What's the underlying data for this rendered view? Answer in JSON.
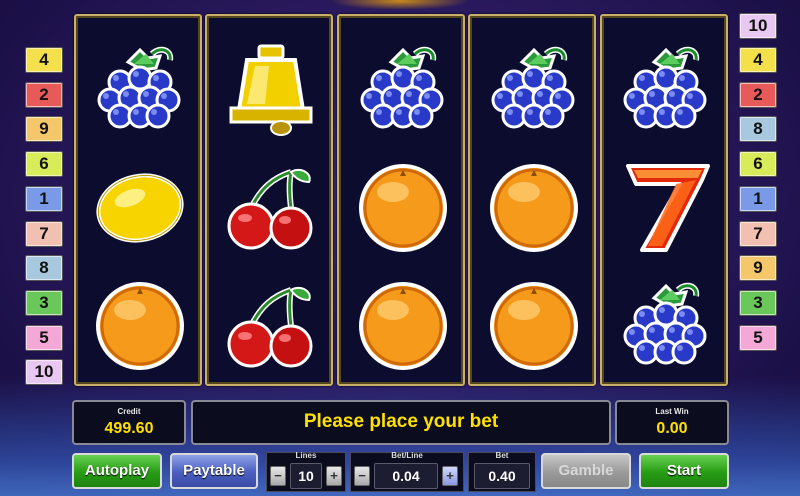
{
  "left_markers": [
    {
      "label": "4",
      "color": "#f4e04a"
    },
    {
      "label": "2",
      "color": "#e85a5a"
    },
    {
      "label": "9",
      "color": "#f4c86a"
    },
    {
      "label": "6",
      "color": "#d8ec5a"
    },
    {
      "label": "1",
      "color": "#7a9ae8"
    },
    {
      "label": "7",
      "color": "#f2c0b0"
    },
    {
      "label": "8",
      "color": "#a8c8e0"
    },
    {
      "label": "3",
      "color": "#6ac85a"
    },
    {
      "label": "5",
      "color": "#f4a8d8"
    },
    {
      "label": "10",
      "color": "#e8c8f0"
    }
  ],
  "right_markers": [
    {
      "label": "10",
      "color": "#e8c8f0"
    },
    {
      "label": "4",
      "color": "#f4e04a"
    },
    {
      "label": "2",
      "color": "#e85a5a"
    },
    {
      "label": "8",
      "color": "#a8c8e0"
    },
    {
      "label": "6",
      "color": "#d8ec5a"
    },
    {
      "label": "1",
      "color": "#7a9ae8"
    },
    {
      "label": "7",
      "color": "#f2c0b0"
    },
    {
      "label": "9",
      "color": "#f4c86a"
    },
    {
      "label": "3",
      "color": "#6ac85a"
    },
    {
      "label": "5",
      "color": "#f4a8d8"
    }
  ],
  "reels": [
    [
      "grapes-icon",
      "lemon-icon",
      "orange-icon"
    ],
    [
      "bell-icon",
      "cherries-icon",
      "cherries-icon"
    ],
    [
      "grapes-icon",
      "orange-icon",
      "orange-icon"
    ],
    [
      "grapes-icon",
      "orange-icon",
      "orange-icon"
    ],
    [
      "grapes-icon",
      "seven-icon",
      "grapes-icon"
    ]
  ],
  "credit": {
    "label": "Credit",
    "value": "499.60"
  },
  "message": "Please place your bet",
  "last_win": {
    "label": "Last Win",
    "value": "0.00"
  },
  "buttons": {
    "autoplay": "Autoplay",
    "paytable": "Paytable",
    "gamble": "Gamble",
    "start": "Start"
  },
  "controls": {
    "lines_label": "Lines",
    "lines_value": "10",
    "bet_line_label": "Bet/Line",
    "bet_line_value": "0.04",
    "bet_label": "Bet",
    "bet_value": "0.40",
    "minus": "−",
    "plus": "+"
  },
  "colors": {
    "reel_frame": "#c9b06a",
    "reel_bg": "#0c0d2e",
    "value_text": "#ffe000",
    "button_green": "#279c14",
    "button_blue": "#4a5ec0",
    "button_gray": "#9a9a9a"
  }
}
